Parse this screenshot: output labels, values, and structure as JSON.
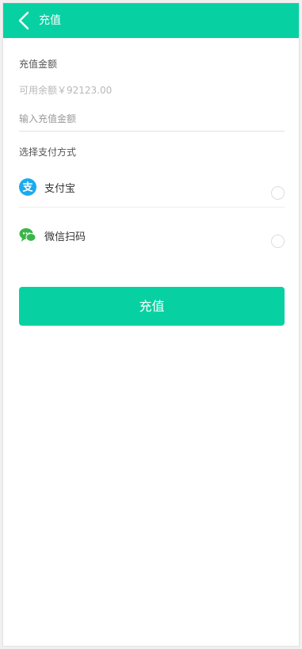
{
  "header": {
    "title": "充值"
  },
  "form": {
    "amount_label": "充值金额",
    "balance_text": "可用余额￥92123.00",
    "amount_placeholder": "输入充值金额",
    "amount_value": "",
    "payment_label": "选择支付方式"
  },
  "payment_methods": [
    {
      "label": "支付宝",
      "icon": "alipay-icon",
      "color": "#1aabee",
      "selected": false
    },
    {
      "label": "微信扫码",
      "icon": "wechat-icon",
      "color": "#3ab54a",
      "selected": false
    }
  ],
  "submit": {
    "label": "充值"
  },
  "colors": {
    "accent": "#07d1a2"
  }
}
